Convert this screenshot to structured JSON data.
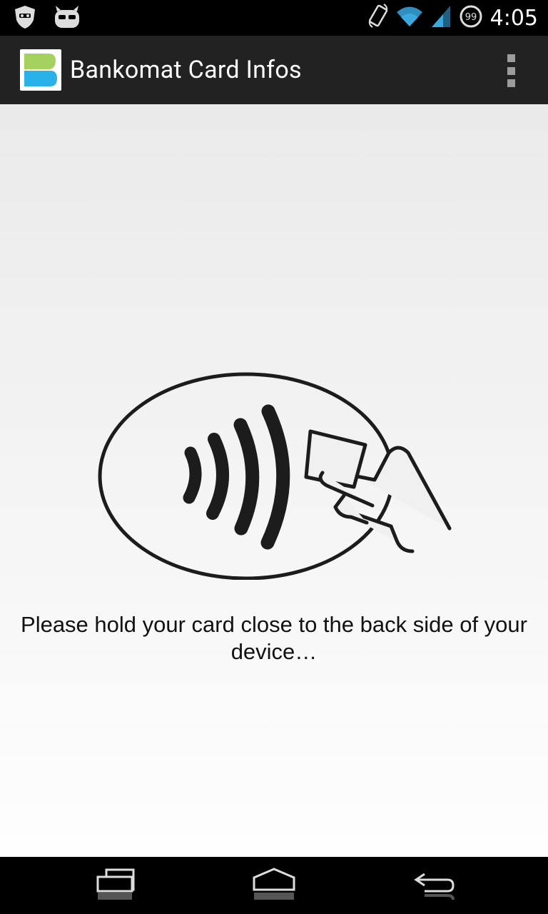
{
  "status_bar": {
    "time": "4:05",
    "battery_level": "99",
    "icons": [
      "privacy-guard-icon",
      "cyanogen-mascot-icon",
      "screen-rotation-icon",
      "wifi-icon",
      "cell-signal-icon",
      "battery-icon"
    ]
  },
  "action_bar": {
    "title": "Bankomat Card Infos",
    "logo_icon": "bankomat-logo-icon",
    "menu_icon": "overflow-menu-icon"
  },
  "main": {
    "illustration": "contactless-nfc-icon",
    "message": "Please hold your card close to the back side of your device…"
  },
  "nav_bar": {
    "buttons": [
      "recent-apps-icon",
      "home-icon",
      "back-icon"
    ]
  },
  "colors": {
    "status_bar": "#000000",
    "action_bar": "#222222",
    "logo_green": "#a5d25f",
    "logo_blue": "#29b2ea"
  }
}
